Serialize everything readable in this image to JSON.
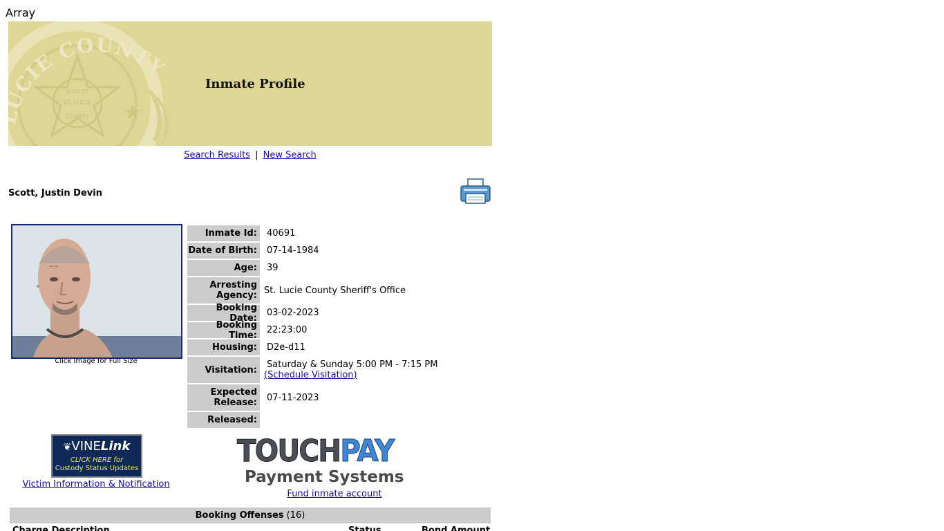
{
  "page": {
    "debug_text": "Array",
    "banner": {
      "title": "Inmate Profile",
      "seal_text": "LUCIE COUNTY",
      "seal_inner_top": "SHERIFF",
      "seal_inner_mid": "ST. LUCIE",
      "seal_inner_bottom": "COUNTY",
      "seal_edge_letter": "S"
    },
    "nav": {
      "search_results": "Search Results",
      "separator": "|",
      "new_search": "New Search"
    },
    "inmate": {
      "name": "Scott, Justin Devin",
      "photo_caption": "Click Image for Full Size"
    },
    "details": [
      {
        "label": "Inmate Id:",
        "value": "40691"
      },
      {
        "label": "Date of Birth:",
        "value": "07-14-1984"
      },
      {
        "label": "Age:",
        "value": "39"
      },
      {
        "label": "Arresting Agency:",
        "value": "St. Lucie County Sheriff's Office"
      },
      {
        "label": "Booking Date:",
        "value": "03-02-2023"
      },
      {
        "label": "Booking Time:",
        "value": "22:23:00"
      },
      {
        "label": "Housing:",
        "value": "D2e-d11"
      },
      {
        "label": "Visitation:",
        "value": "Saturday & Sunday 5:00 PM - 7:15 PM",
        "link": "(Schedule Visitation)"
      },
      {
        "label": "Expected Release:",
        "value": "07-11-2023"
      },
      {
        "label": "Released:",
        "value": ""
      }
    ],
    "vine": {
      "brand_a": "VINE",
      "brand_b": "Link",
      "line1": "CLICK HERE for",
      "line2": "Custody Status Updates",
      "link_text": "Victim Information & Notification"
    },
    "touchpay": {
      "brand_a": "TOUCH",
      "brand_b": "PAY",
      "subtitle": "Payment Systems",
      "link_text": "Fund inmate account"
    },
    "offenses": {
      "title": "Booking Offenses",
      "count": "(16)",
      "headers": {
        "charge": "Charge Description",
        "status": "Status",
        "bond": "Bond Amount"
      }
    }
  },
  "colors": {
    "banner_bg": "#ded695",
    "label_bg": "#cccccc",
    "link": "#1a0dab",
    "photo_border": "#1c2a6e"
  }
}
